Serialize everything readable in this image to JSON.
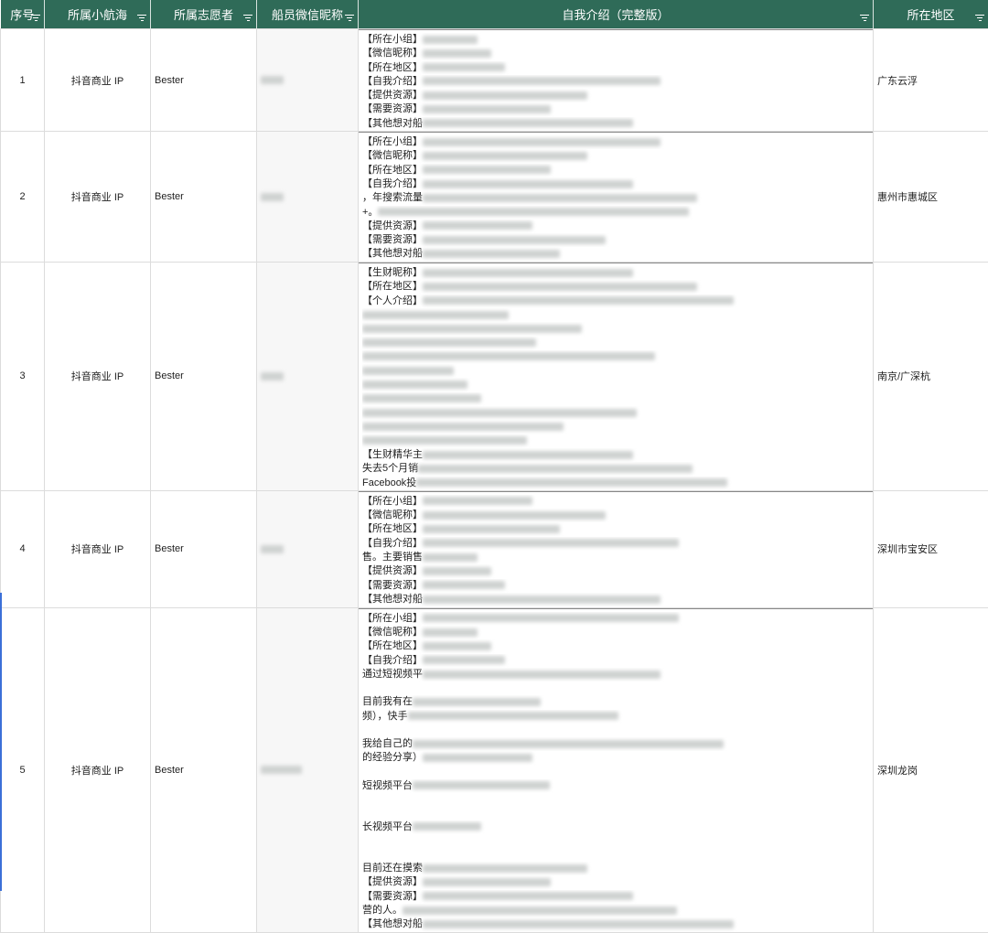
{
  "headers": [
    {
      "label": "序号",
      "key": "idx"
    },
    {
      "label": "所属小航海",
      "key": "team"
    },
    {
      "label": "所属志愿者",
      "key": "volunteer"
    },
    {
      "label": "船员微信昵称",
      "key": "nick"
    },
    {
      "label": "自我介绍（完整版）",
      "key": "intro"
    },
    {
      "label": "所在地区",
      "key": "region"
    }
  ],
  "rows": [
    {
      "idx": "1",
      "team": "抖音商业 IP",
      "volunteer": "Bester",
      "region": "广东云浮",
      "intro": [
        "【所在小组】",
        "【微信昵称】",
        "【所在地区】",
        "【自我介绍】",
        "【提供资源】",
        "【需要资源】",
        "【其他想对船"
      ]
    },
    {
      "idx": "2",
      "team": "抖音商业 IP",
      "volunteer": "Bester",
      "region": "惠州市惠城区",
      "intro": [
        "【所在小组】",
        "【微信昵称】",
        "【所在地区】",
        "【自我介绍】",
        "，年搜索流量",
        "+。",
        "【提供资源】",
        "【需要资源】",
        "【其他想对船"
      ]
    },
    {
      "idx": "3",
      "team": "抖音商业 IP",
      "volunteer": "Bester",
      "region": "南京/广深杭",
      "intro": [
        "【生财昵称】",
        "【所在地区】",
        "【个人介绍】",
        "",
        "",
        "",
        "",
        "",
        "",
        "",
        "",
        "",
        "",
        "【生财精华主",
        "失去5个月销",
        "Facebook投"
      ]
    },
    {
      "idx": "4",
      "team": "抖音商业 IP",
      "volunteer": "Bester",
      "region": "深圳市宝安区",
      "intro": [
        "【所在小组】",
        "【微信昵称】",
        "【所在地区】",
        "【自我介绍】",
        "售。主要销售",
        "【提供资源】",
        "【需要资源】",
        "【其他想对船"
      ]
    },
    {
      "idx": "5",
      "team": "抖音商业 IP",
      "volunteer": "Bester",
      "region": "深圳龙岗",
      "intro": [
        "【所在小组】",
        "【微信昵称】",
        "【所在地区】",
        "【自我介绍】",
        "通过短视频平",
        "",
        " 目前我有在",
        "频），快手",
        "",
        " 我给自己的",
        "的经验分享）",
        "",
        " 短视频平台",
        "",
        "",
        " 长视频平台",
        "",
        "",
        " 目前还在摸索",
        "【提供资源】",
        "【需要资源】",
        "营的人。",
        "【其他想对船"
      ]
    }
  ]
}
